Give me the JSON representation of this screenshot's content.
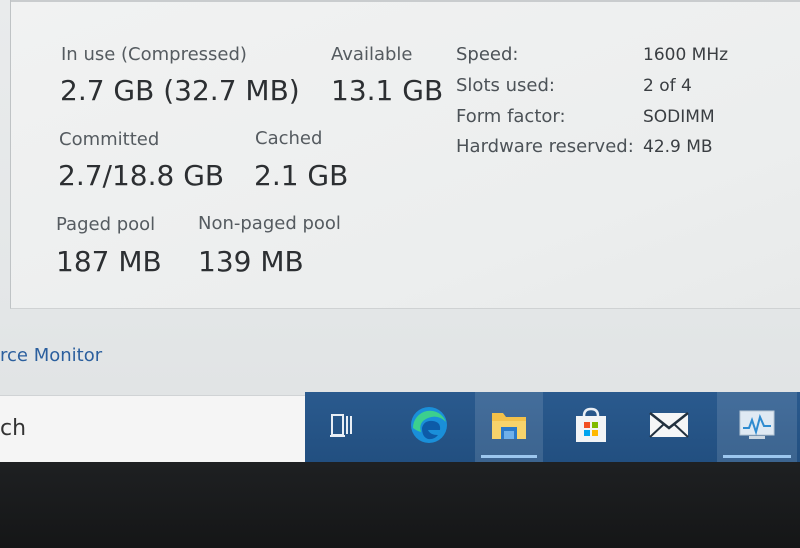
{
  "memory": {
    "in_use_label": "In use (Compressed)",
    "in_use_value": "2.7 GB (32.7 MB)",
    "available_label": "Available",
    "available_value": "13.1 GB",
    "committed_label": "Committed",
    "committed_value": "2.7/18.8 GB",
    "cached_label": "Cached",
    "cached_value": "2.1 GB",
    "paged_pool_label": "Paged pool",
    "paged_pool_value": "187 MB",
    "non_paged_pool_label": "Non-paged pool",
    "non_paged_pool_value": "139 MB"
  },
  "details": {
    "speed_label": "Speed:",
    "speed_value": "1600 MHz",
    "slots_label": "Slots used:",
    "slots_value": "2 of 4",
    "form_factor_label": "Form factor:",
    "form_factor_value": "SODIMM",
    "hw_reserved_label": "Hardware reserved:",
    "hw_reserved_value": "42.9 MB"
  },
  "footer": {
    "resource_monitor_link": "rce Monitor"
  },
  "search": {
    "partial_text": "ch"
  },
  "taskbar": {
    "icons": [
      "task-view-icon",
      "edge-icon",
      "file-explorer-icon",
      "store-icon",
      "mail-icon",
      "task-manager-icon"
    ],
    "accent_color": "#2a5a8e"
  }
}
